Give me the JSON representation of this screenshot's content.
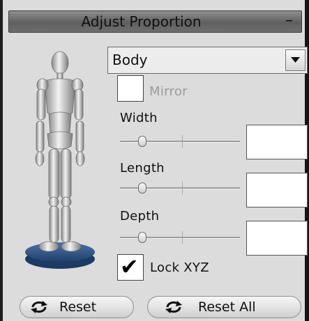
{
  "panel": {
    "title": "Adjust Proportion",
    "collapse_label": "–"
  },
  "body_part": {
    "selected": "Body"
  },
  "mirror": {
    "label": "Mirror",
    "checked": false,
    "enabled": false
  },
  "width": {
    "label": "Width",
    "value": ""
  },
  "length": {
    "label": "Length",
    "value": ""
  },
  "depth": {
    "label": "Depth",
    "value": ""
  },
  "lock_xyz": {
    "label": "Lock XYZ",
    "checked": true,
    "check_glyph": "✔"
  },
  "buttons": {
    "reset": "Reset",
    "reset_all": "Reset All"
  },
  "colors": {
    "accent_base": "#2f5a8f",
    "figure": "#d0d0d0"
  }
}
